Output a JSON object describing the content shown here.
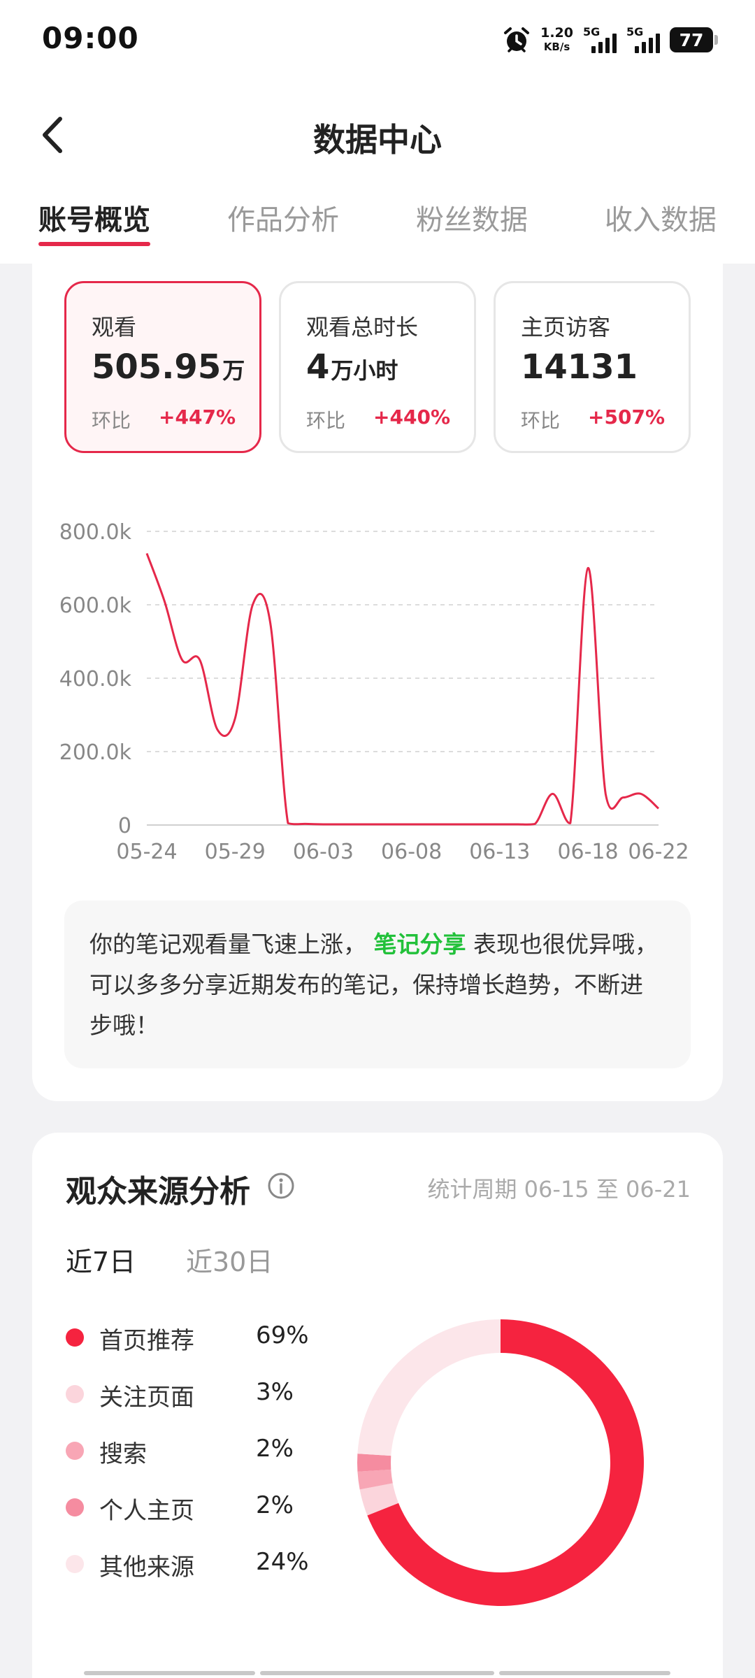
{
  "status_bar": {
    "time": "09:00",
    "net_speed_value": "1.20",
    "net_speed_unit": "KB/s",
    "signal1_label": "5G",
    "signal2_label": "5G",
    "battery": "77",
    "icons": [
      "alarm-icon",
      "signal-icon",
      "battery-icon"
    ]
  },
  "header": {
    "title": "数据中心",
    "back_icon": "chevron-left-icon"
  },
  "tabs": [
    {
      "label": "账号概览",
      "active": true
    },
    {
      "label": "作品分析",
      "active": false
    },
    {
      "label": "粉丝数据",
      "active": false
    },
    {
      "label": "收入数据",
      "active": false
    }
  ],
  "metrics": [
    {
      "label": "观看",
      "value": "505.95",
      "unit": "万",
      "compare_label": "环比",
      "change": "+447%",
      "active": true
    },
    {
      "label": "观看总时长",
      "value": "4",
      "unit": "万小时",
      "compare_label": "环比",
      "change": "+440%",
      "active": false
    },
    {
      "label": "主页访客",
      "value": "14131",
      "unit": "",
      "compare_label": "环比",
      "change": "+507%",
      "active": false
    }
  ],
  "chart_data": [
    {
      "type": "line",
      "title": "",
      "xlabel": "",
      "ylabel": "",
      "x_tick_labels": [
        "05-24",
        "05-29",
        "06-03",
        "06-08",
        "06-13",
        "06-18",
        "06-22"
      ],
      "y_tick_labels": [
        "800.0k",
        "600.0k",
        "400.0k",
        "200.0k",
        "0"
      ],
      "y_ticks": [
        800000,
        600000,
        400000,
        200000,
        0
      ],
      "ylim": [
        0,
        800000
      ],
      "grid": true,
      "color": "#e5284a",
      "x": [
        "05-24",
        "05-25",
        "05-26",
        "05-27",
        "05-28",
        "05-29",
        "05-30",
        "05-31",
        "06-01",
        "06-02",
        "06-03",
        "06-04",
        "06-05",
        "06-06",
        "06-07",
        "06-08",
        "06-09",
        "06-10",
        "06-11",
        "06-12",
        "06-13",
        "06-14",
        "06-15",
        "06-16",
        "06-17",
        "06-18",
        "06-19",
        "06-20",
        "06-21",
        "06-22"
      ],
      "values": [
        740000,
        610000,
        450000,
        450000,
        260000,
        290000,
        600000,
        550000,
        5000,
        3000,
        2000,
        2000,
        2000,
        2000,
        2000,
        2000,
        2000,
        2000,
        2000,
        2000,
        2000,
        2000,
        3000,
        85000,
        5000,
        700000,
        85000,
        75000,
        85000,
        45000
      ]
    },
    {
      "type": "pie",
      "title": "",
      "donut": true,
      "categories": [
        "首页推荐",
        "关注页面",
        "搜索",
        "个人主页",
        "其他来源"
      ],
      "values": [
        69,
        3,
        2,
        2,
        24
      ],
      "colors": [
        "#f5233f",
        "#fbd5dc",
        "#f8a6b5",
        "#f58ca0",
        "#fce6ea"
      ]
    }
  ],
  "insight": {
    "text_before": "你的笔记观看量飞速上涨，",
    "highlight": "笔记分享",
    "text_after": "表现也很优异哦，可以多多分享近期发布的笔记，保持增长趋势，不断进步哦！"
  },
  "audience": {
    "title": "观众来源分析",
    "info_icon": "info-icon",
    "period": "统计周期 06-15 至 06-21",
    "segments": [
      {
        "label": "近7日",
        "active": true
      },
      {
        "label": "近30日",
        "active": false
      }
    ],
    "legend": [
      {
        "name": "首页推荐",
        "pct": "69%",
        "color": "#f5233f"
      },
      {
        "name": "关注页面",
        "pct": "3%",
        "color": "#fbd5dc"
      },
      {
        "name": "搜索",
        "pct": "2%",
        "color": "#f8a6b5"
      },
      {
        "name": "个人主页",
        "pct": "2%",
        "color": "#f58ca0"
      },
      {
        "name": "其他来源",
        "pct": "24%",
        "color": "#fce6ea"
      }
    ]
  }
}
